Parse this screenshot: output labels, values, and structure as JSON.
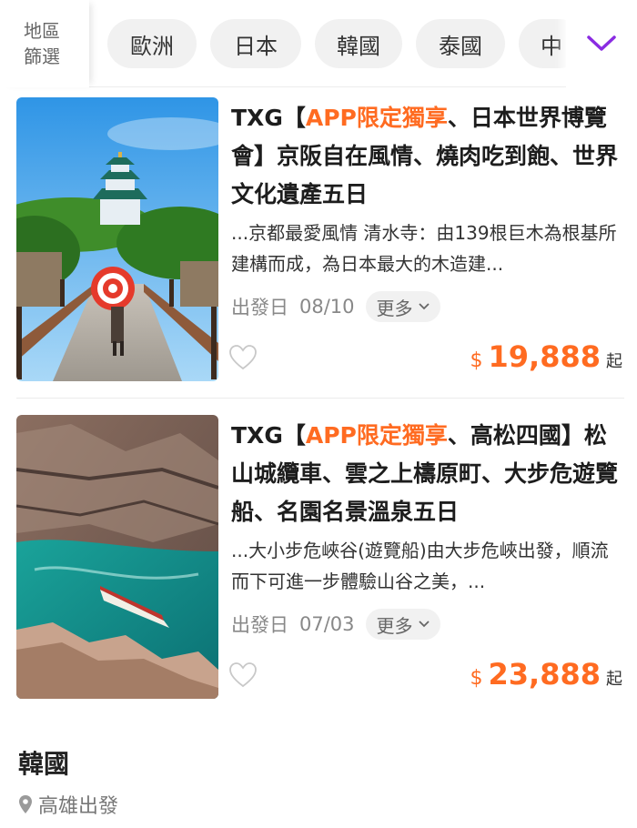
{
  "filter": {
    "label_line1": "地區",
    "label_line2": "篩選",
    "chips": [
      "歐洲",
      "日本",
      "韓國",
      "泰國",
      "中"
    ]
  },
  "colors": {
    "accent": "#ff6b21",
    "expand_icon": "#8a2be2"
  },
  "products": [
    {
      "title_prefix": "TXG【",
      "title_highlight": "APP限定獨享",
      "title_rest": "、日本世界博覽會】京阪自在風情、燒肉吃到飽、世界文化遺產五日",
      "description": "...京都最愛風情 清水寺：由139根巨木為根基所建構而成，為日本最大的木造建...",
      "depart_label": "出發日",
      "depart_date": "08/10",
      "more_label": "更多",
      "currency": "$",
      "price": "19,888",
      "price_suffix": "起",
      "image_icon": "osaka-castle-photo"
    },
    {
      "title_prefix": "TXG【",
      "title_highlight": "APP限定獨享",
      "title_rest": "、高松四國】松山城纜車、雲之上檮原町、大步危遊覽船、名園名景溫泉五日",
      "description": "...大小步危峽谷(遊覽船)由大步危峽出發，順流而下可進一步體驗山谷之美，...",
      "depart_label": "出發日",
      "depart_date": "07/03",
      "more_label": "更多",
      "currency": "$",
      "price": "23,888",
      "price_suffix": "起",
      "image_icon": "gorge-boat-photo"
    }
  ],
  "section": {
    "title": "韓國",
    "subtitle": "高雄出發"
  }
}
